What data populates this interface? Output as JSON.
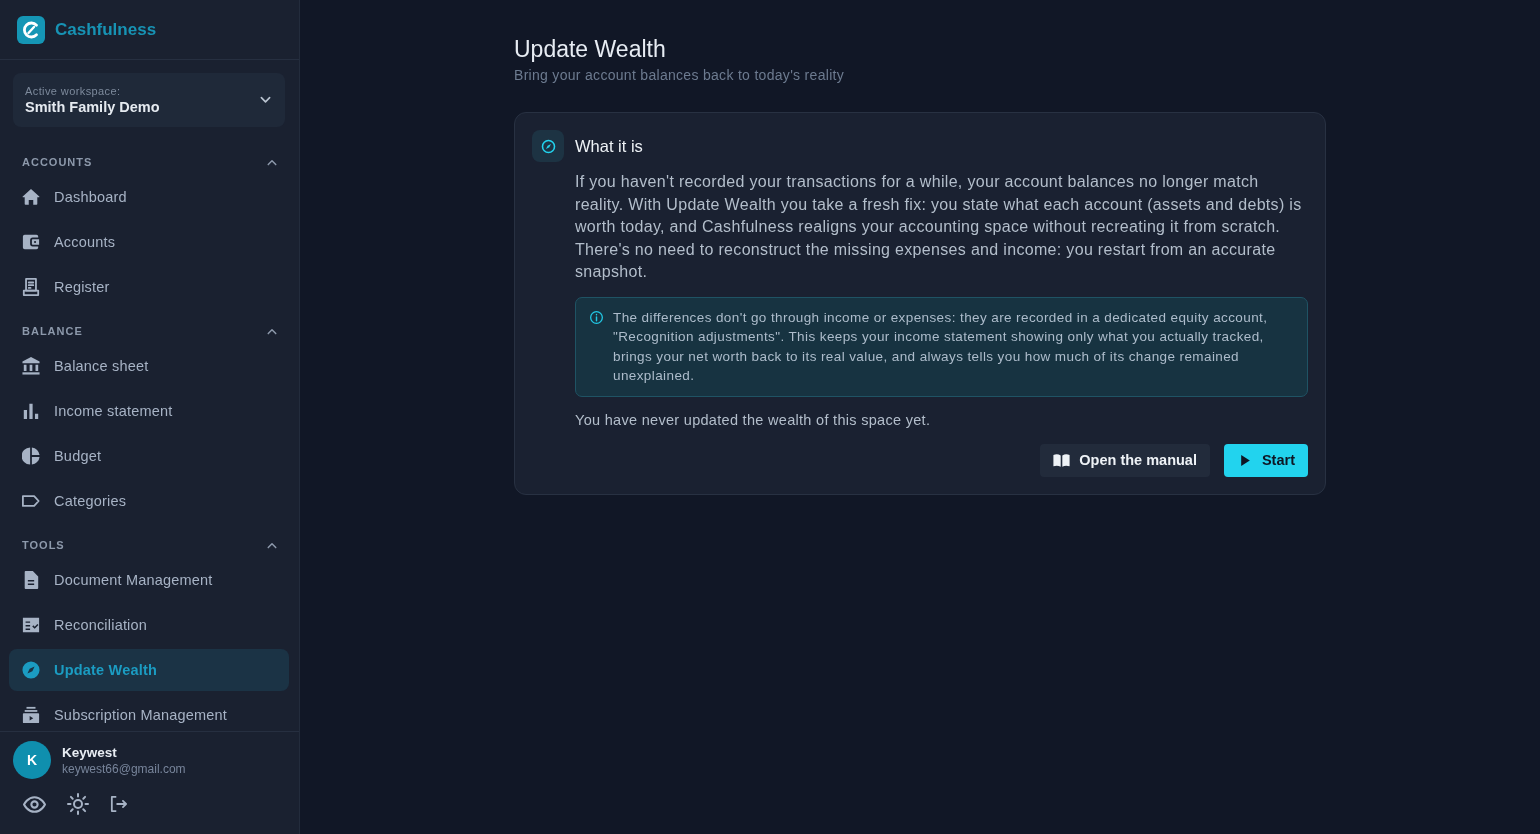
{
  "app": {
    "name": "Cashfulness"
  },
  "workspace": {
    "label": "Active workspace:",
    "name": "Smith Family Demo"
  },
  "sidebar": {
    "sections": [
      {
        "title": "ACCOUNTS",
        "expanded": true,
        "items": [
          {
            "label": "Dashboard",
            "selected": false
          },
          {
            "label": "Accounts",
            "selected": false
          },
          {
            "label": "Register",
            "selected": false
          }
        ]
      },
      {
        "title": "BALANCE",
        "expanded": true,
        "items": [
          {
            "label": "Balance sheet",
            "selected": false
          },
          {
            "label": "Income statement",
            "selected": false
          },
          {
            "label": "Budget",
            "selected": false
          },
          {
            "label": "Categories",
            "selected": false
          }
        ]
      },
      {
        "title": "TOOLS",
        "expanded": true,
        "items": [
          {
            "label": "Document Management",
            "selected": false
          },
          {
            "label": "Reconciliation",
            "selected": false
          },
          {
            "label": "Update Wealth",
            "selected": true
          },
          {
            "label": "Subscription Management",
            "selected": false
          }
        ]
      }
    ]
  },
  "user": {
    "initial": "K",
    "name": "Keywest",
    "email": "keywest66@gmail.com"
  },
  "page": {
    "title": "Update Wealth",
    "subtitle": "Bring your account balances back to today's reality"
  },
  "card": {
    "heading": "What it is",
    "body": "If you haven't recorded your transactions for a while, your account balances no longer match reality. With Update Wealth you take a fresh fix: you state what each account (assets and debts) is worth today, and Cashfulness realigns your accounting space without recreating it from scratch. There's no need to reconstruct the missing expenses and income: you restart from an accurate snapshot.",
    "note": "The differences don't go through income or expenses: they are recorded in a dedicated equity account, \"Recognition adjustments\". This keeps your income statement showing only what you actually tracked, brings your net worth back to its real value, and always tells you how much of its change remained unexplained.",
    "status": "You have never updated the wealth of this space yet.",
    "buttons": [
      {
        "label": "Open the manual",
        "kind": "secondary"
      },
      {
        "label": "Start",
        "kind": "primary"
      }
    ]
  }
}
